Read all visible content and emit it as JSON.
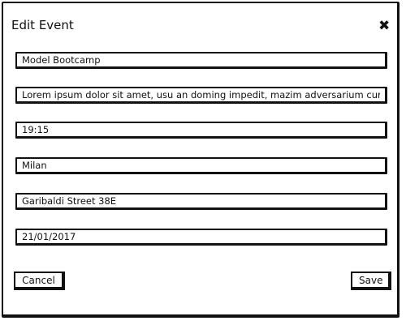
{
  "dialog": {
    "title": "Edit Event",
    "close_glyph": "✖",
    "close_icon": "close-icon"
  },
  "fields": {
    "name": "Model Bootcamp",
    "description": "Lorem ipsum dolor sit amet, usu an doming impedit, mazim adversarium cur",
    "time": "19:15",
    "city": "Milan",
    "address": "Garibaldi Street 38E",
    "date": "21/01/2017"
  },
  "actions": {
    "cancel_label": "Cancel",
    "save_label": "Save"
  }
}
